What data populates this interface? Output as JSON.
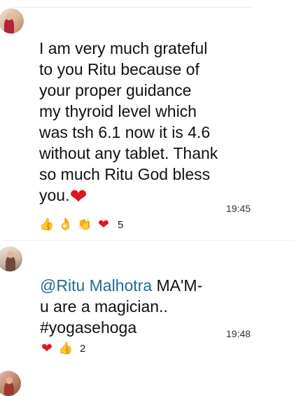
{
  "comments": [
    {
      "lines": [
        "I am very much grateful",
        "to you Ritu because  of",
        "your proper guidance",
        "my thyroid  level  which",
        "was tsh 6.1 now it is 4.6",
        "without any tablet. Thank",
        "so much Ritu God bless",
        "you."
      ],
      "trailing_emoji": "❤",
      "time": "19:45",
      "reactions": {
        "icons": [
          "👍",
          "👌",
          "👏",
          "❤"
        ],
        "count": "5"
      }
    },
    {
      "mention": "@Ritu Malhotra",
      "first_line_rest": " MA'M-",
      "lines": [
        "u are a magician..",
        "#yogasehoga"
      ],
      "time": "19:48",
      "reactions": {
        "icons": [
          "❤",
          "👍"
        ],
        "count": "2"
      }
    }
  ],
  "colors": {
    "mention": "#1f6d8c",
    "heart": "#e0161f",
    "text": "#111111"
  }
}
